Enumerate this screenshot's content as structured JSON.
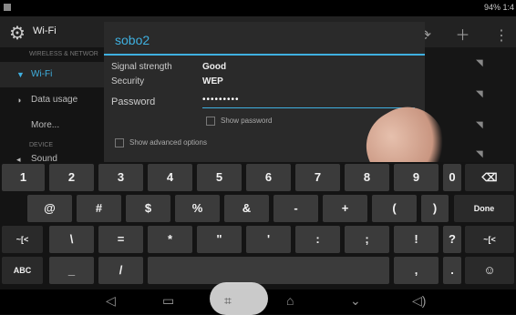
{
  "status": {
    "battery": "94% 1:4"
  },
  "actionbar": {
    "title": "Wi-Fi"
  },
  "sidebar": {
    "header_wireless": "WIRELESS & NETWOR",
    "items": [
      {
        "label": "Wi-Fi"
      },
      {
        "label": "Data usage"
      },
      {
        "label": "More..."
      }
    ],
    "header_device": "DEVICE",
    "partial_item": "Sound"
  },
  "dialog": {
    "title": "sobo2",
    "signal_label": "Signal strength",
    "signal_value": "Good",
    "security_label": "Security",
    "security_value": "WEP",
    "password_label": "Password",
    "password_value": "•••••••••",
    "show_password": "Show password",
    "show_advanced": "Show advanced options"
  },
  "keyboard": {
    "row1": [
      "1",
      "2",
      "3",
      "4",
      "5",
      "6",
      "7",
      "8",
      "9",
      "0"
    ],
    "row2": [
      "@",
      "#",
      "$",
      "%",
      "&",
      "-",
      "+",
      "(",
      ")"
    ],
    "done": "Done",
    "row3": [
      "~[<",
      "\\",
      "=",
      "*",
      "\"",
      "'",
      ":",
      ";",
      "!",
      "?",
      "~[<"
    ],
    "abc": "ABC",
    "row4": [
      "_",
      "/",
      ",",
      "."
    ]
  }
}
